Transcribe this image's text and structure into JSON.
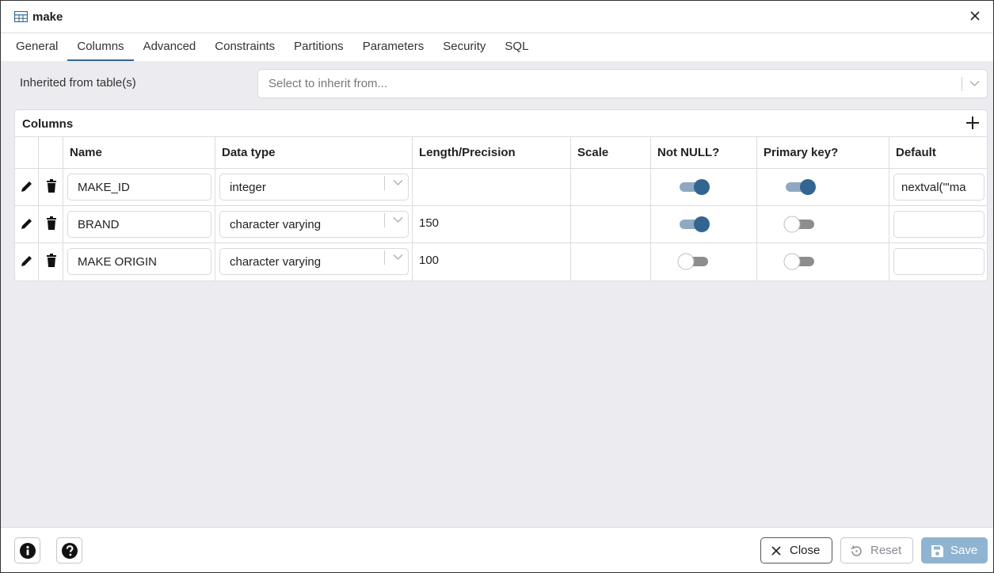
{
  "window": {
    "title": "make"
  },
  "tabs": [
    "General",
    "Columns",
    "Advanced",
    "Constraints",
    "Partitions",
    "Parameters",
    "Security",
    "SQL"
  ],
  "active_tab": "Columns",
  "inherit": {
    "label": "Inherited from table(s)",
    "placeholder": "Select to inherit from..."
  },
  "columns_panel": {
    "title": "Columns",
    "headers": {
      "name": "Name",
      "data_type": "Data type",
      "length": "Length/Precision",
      "scale": "Scale",
      "not_null": "Not NULL?",
      "primary_key": "Primary key?",
      "default": "Default"
    },
    "rows": [
      {
        "name": "MAKE_ID",
        "data_type": "integer",
        "length": "",
        "scale": "",
        "not_null": true,
        "primary_key": true,
        "default": "nextval('\"ma"
      },
      {
        "name": "BRAND",
        "data_type": "character varying",
        "length": "150",
        "scale": "",
        "not_null": true,
        "primary_key": false,
        "default": ""
      },
      {
        "name": "MAKE ORIGIN",
        "data_type": "character varying",
        "length": "100",
        "scale": "",
        "not_null": false,
        "primary_key": false,
        "default": ""
      }
    ]
  },
  "footer": {
    "close_label": "Close",
    "reset_label": "Reset",
    "save_label": "Save"
  },
  "colors": {
    "accent": "#326690",
    "toggle_on_track": "#8fa9c2",
    "toggle_off_track": "#8d8d8d",
    "save_bg": "#8fb4d2"
  }
}
